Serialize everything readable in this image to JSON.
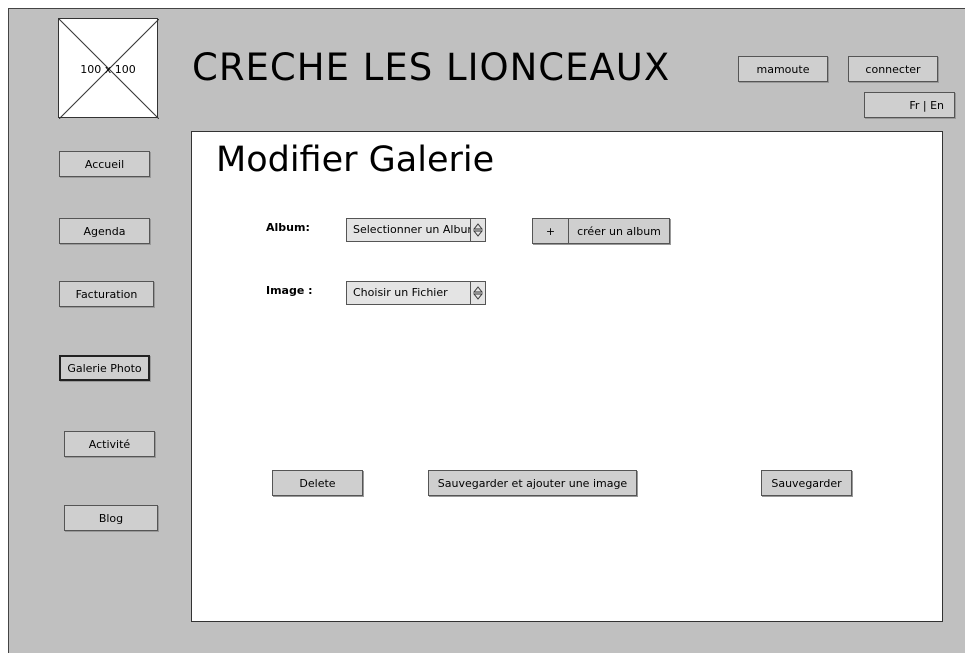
{
  "header": {
    "logo_placeholder": "100 x 100",
    "site_title": "CRECHE LES LIONCEAUX",
    "user_button": "mamoute",
    "connect_button": "connecter",
    "lang_button": "Fr | En"
  },
  "sidebar": {
    "items": [
      {
        "label": "Accueil"
      },
      {
        "label": "Agenda"
      },
      {
        "label": "Facturation"
      },
      {
        "label": "Galerie Photo",
        "active": true
      },
      {
        "label": "Activité"
      },
      {
        "label": "Blog"
      }
    ]
  },
  "main": {
    "title": "Modifier  Galerie",
    "album_label": "Album:",
    "album_select_value": "Selectionner un Album",
    "add_album_plus": "+",
    "add_album_label": "créer un album",
    "image_label": "Image :",
    "image_select_value": "Choisir un Fichier",
    "delete_button": "Delete",
    "save_add_button": "Sauvegarder et ajouter une image",
    "save_button": "Sauvegarder"
  },
  "colors": {
    "background": "#c0c0c0",
    "content": "#ffffff",
    "button": "#cfcfcf"
  }
}
